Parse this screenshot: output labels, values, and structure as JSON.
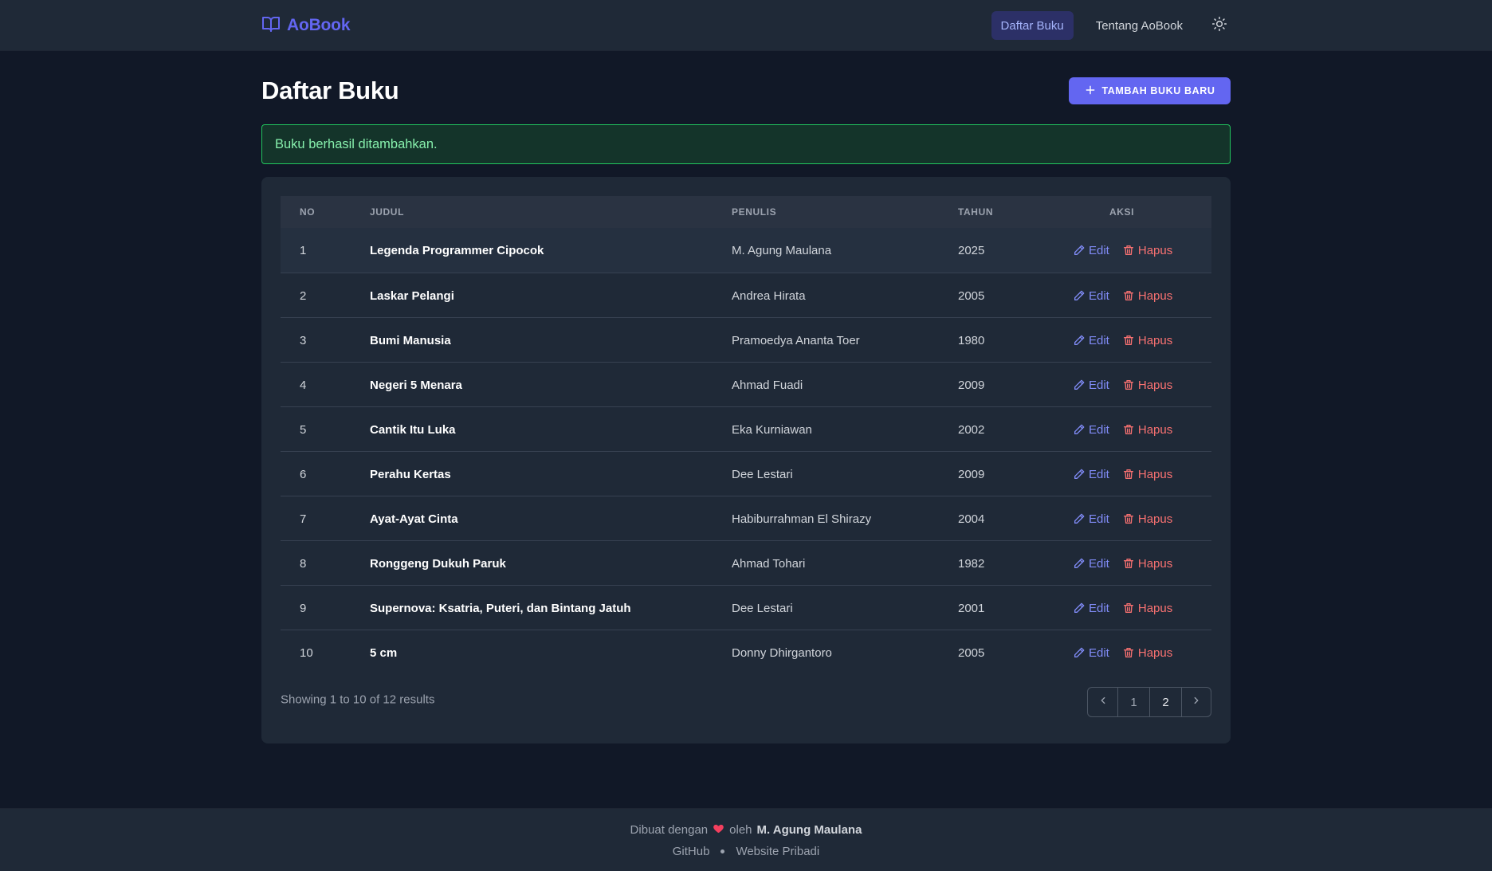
{
  "nav": {
    "brand": "AoBook",
    "links": [
      "Daftar Buku",
      "Tentang AoBook"
    ],
    "active_index": 0
  },
  "page": {
    "title": "Daftar Buku",
    "add_button": "TAMBAH BUKU BARU"
  },
  "alert": {
    "message": "Buku berhasil ditambahkan."
  },
  "table": {
    "headers": {
      "no": "NO",
      "title": "JUDUL",
      "author": "PENULIS",
      "year": "TAHUN",
      "actions": "AKSI"
    },
    "edit_label": "Edit",
    "delete_label": "Hapus",
    "rows": [
      {
        "no": "1",
        "title": "Legenda Programmer Cipocok",
        "author": "M. Agung Maulana",
        "year": "2025"
      },
      {
        "no": "2",
        "title": "Laskar Pelangi",
        "author": "Andrea Hirata",
        "year": "2005"
      },
      {
        "no": "3",
        "title": "Bumi Manusia",
        "author": "Pramoedya Ananta Toer",
        "year": "1980"
      },
      {
        "no": "4",
        "title": "Negeri 5 Menara",
        "author": "Ahmad Fuadi",
        "year": "2009"
      },
      {
        "no": "5",
        "title": "Cantik Itu Luka",
        "author": "Eka Kurniawan",
        "year": "2002"
      },
      {
        "no": "6",
        "title": "Perahu Kertas",
        "author": "Dee Lestari",
        "year": "2009"
      },
      {
        "no": "7",
        "title": "Ayat-Ayat Cinta",
        "author": "Habiburrahman El Shirazy",
        "year": "2004"
      },
      {
        "no": "8",
        "title": "Ronggeng Dukuh Paruk",
        "author": "Ahmad Tohari",
        "year": "1982"
      },
      {
        "no": "9",
        "title": "Supernova: Ksatria, Puteri, dan Bintang Jatuh",
        "author": "Dee Lestari",
        "year": "2001"
      },
      {
        "no": "10",
        "title": "5 cm",
        "author": "Donny Dhirgantoro",
        "year": "2005"
      }
    ]
  },
  "pagination": {
    "summary": "Showing 1 to 10 of 12 results",
    "pages": [
      "1",
      "2"
    ],
    "current": "2"
  },
  "footer": {
    "made_with": "Dibuat dengan",
    "by": "oleh",
    "author": "M. Agung Maulana",
    "links": [
      "GitHub",
      "Website Pribadi"
    ]
  },
  "colors": {
    "accent": "#6366f1",
    "background": "#111827",
    "surface": "#1f2937",
    "success": "#22c55e",
    "danger": "#f87171"
  },
  "icons": {
    "brand": "book-open-icon",
    "theme": "sun-icon",
    "add": "plus-icon",
    "edit": "pencil-icon",
    "delete": "trash-icon",
    "prev": "chevron-left-icon",
    "next": "chevron-right-icon",
    "heart": "heart-icon"
  }
}
